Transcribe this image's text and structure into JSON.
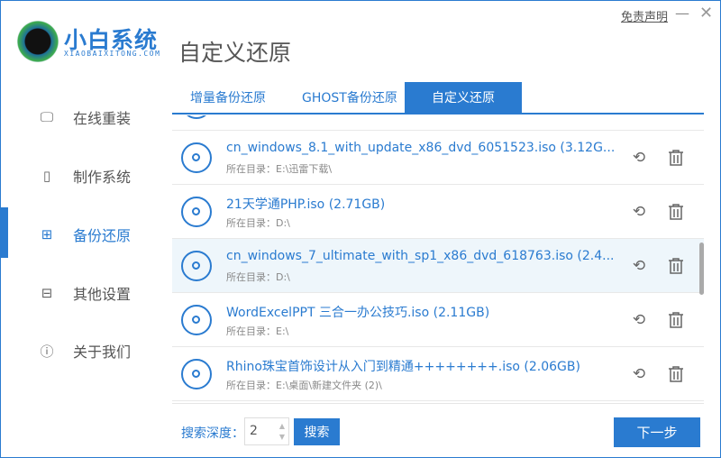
{
  "app": {
    "brand": "小白系统",
    "brand_sub": "XIAOBAIXITONG.COM",
    "title": "自定义还原",
    "disclaimer": "免责声明",
    "minimize": "—",
    "close": "✕",
    "accent": "#2a7bd0"
  },
  "sidebar": {
    "items": [
      {
        "label": "在线重装",
        "icon": "monitor-icon",
        "glyph": "🖵"
      },
      {
        "label": "制作系统",
        "icon": "usb-icon",
        "glyph": "▯"
      },
      {
        "label": "备份还原",
        "icon": "grid-icon",
        "glyph": "⊞",
        "active": true
      },
      {
        "label": "其他设置",
        "icon": "briefcase-icon",
        "glyph": "⊟"
      },
      {
        "label": "关于我们",
        "icon": "info-icon",
        "glyph": "ⓘ"
      }
    ]
  },
  "tabs": [
    {
      "label": "增量备份还原"
    },
    {
      "label": "GHOST备份还原"
    },
    {
      "label": "自定义还原",
      "active": true
    }
  ],
  "files": [
    {
      "name": "cn_windows_8.1_with_update_x86_dvd_6051523.iso (3.12G...",
      "dir": "所在目录：E:\\迅雷下载\\"
    },
    {
      "name": "21天学通PHP.iso (2.71GB)",
      "dir": "所在目录：D:\\"
    },
    {
      "name": "cn_windows_7_ultimate_with_sp1_x86_dvd_618763.iso (2.4...",
      "dir": "所在目录：D:\\",
      "highlighted": true
    },
    {
      "name": "WordExcelPPT 三合一办公技巧.iso (2.11GB)",
      "dir": "所在目录：E:\\"
    },
    {
      "name": "Rhino珠宝首饰设计从入门到精通++++++++.iso (2.06GB)",
      "dir": "所在目录：E:\\桌面\\新建文件夹 (2)\\"
    }
  ],
  "footer": {
    "depth_label": "搜索深度：",
    "depth_value": "2",
    "search": "搜索",
    "next": "下一步"
  }
}
